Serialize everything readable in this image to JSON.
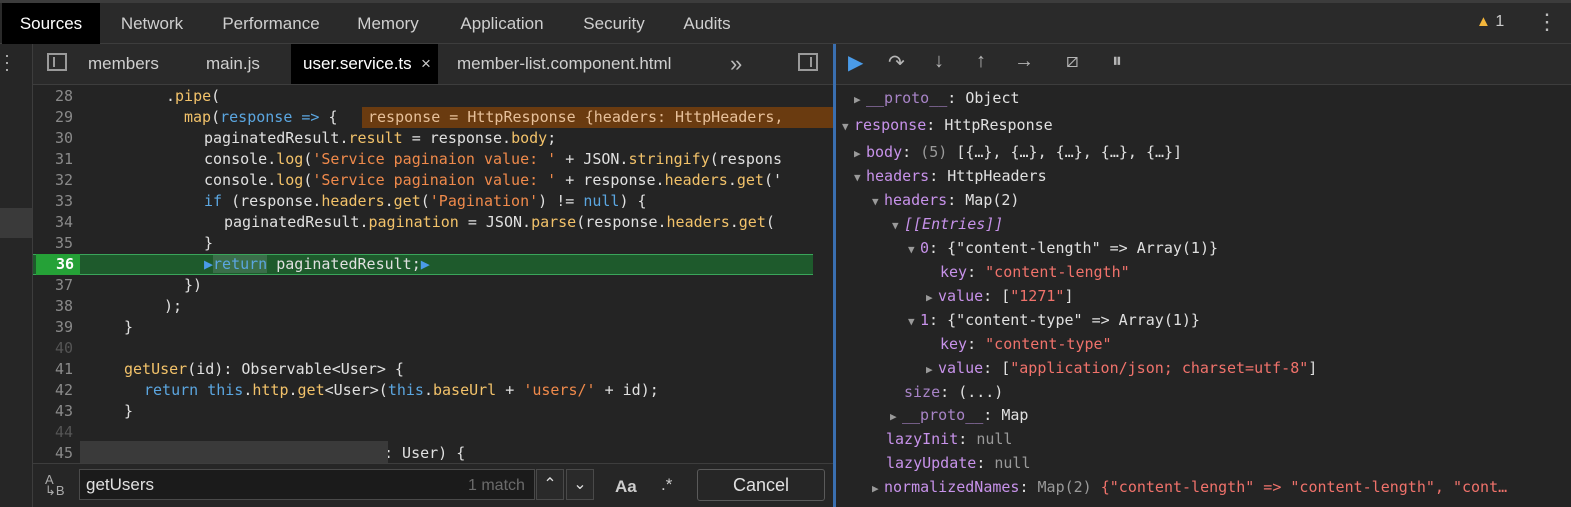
{
  "panel_tabs": [
    "Sources",
    "Network",
    "Performance",
    "Memory",
    "Application",
    "Security",
    "Audits"
  ],
  "warnings": {
    "icon": "warning-icon",
    "count": "1"
  },
  "editor_tabs": [
    "members",
    "main.js",
    "user.service.ts",
    "member-list.component.html"
  ],
  "active_editor_tab": "user.service.ts",
  "more_tabs": "»",
  "tab_close": "×",
  "code": {
    "line_numbers": [
      "28",
      "29",
      "30",
      "31",
      "32",
      "33",
      "34",
      "35",
      "36",
      "37",
      "38",
      "39",
      "40",
      "41",
      "42",
      "43",
      "44",
      "45"
    ],
    "inline_value": "response = HttpResponse {headers: HttpHeaders,",
    "execution_line": "36"
  },
  "search": {
    "query": "getUsers",
    "match_count": "1 match",
    "case_label": "Aa",
    "regex_label": ".*",
    "cancel_label": "Cancel"
  },
  "scope": {
    "proto": "__proto__",
    "proto_value": "Object",
    "response_key": "response",
    "response_value": "HttpResponse",
    "body_key": "body",
    "body_count": "(5)",
    "body_value": "[{…}, {…}, {…}, {…}, {…}]",
    "headers_key": "headers",
    "headers_value": "HttpHeaders",
    "inner_headers_key": "headers",
    "inner_headers_value": "Map(2)",
    "entries": "[[Entries]]",
    "entry0_key": "0",
    "entry0_value": "{\"content-length\" => Array(1)}",
    "key_label": "key",
    "entry0_k": "\"content-length\"",
    "value_label": "value",
    "entry0_v": "\"1271\"",
    "entry1_key": "1",
    "entry1_value": "{\"content-type\" => Array(1)}",
    "entry1_k": "\"content-type\"",
    "entry1_v": "\"application/json; charset=utf-8\"",
    "size_key": "size",
    "size_value": "(...)",
    "map_proto_value": "Map",
    "lazyInit_key": "lazyInit",
    "null_value": "null",
    "lazyUpdate_key": "lazyUpdate",
    "normalizedNames_key": "normalizedNames",
    "normalizedNames_type": "Map(2)",
    "normalizedNames_value": "{\"content-length\" => \"content-length\", \"cont…"
  }
}
